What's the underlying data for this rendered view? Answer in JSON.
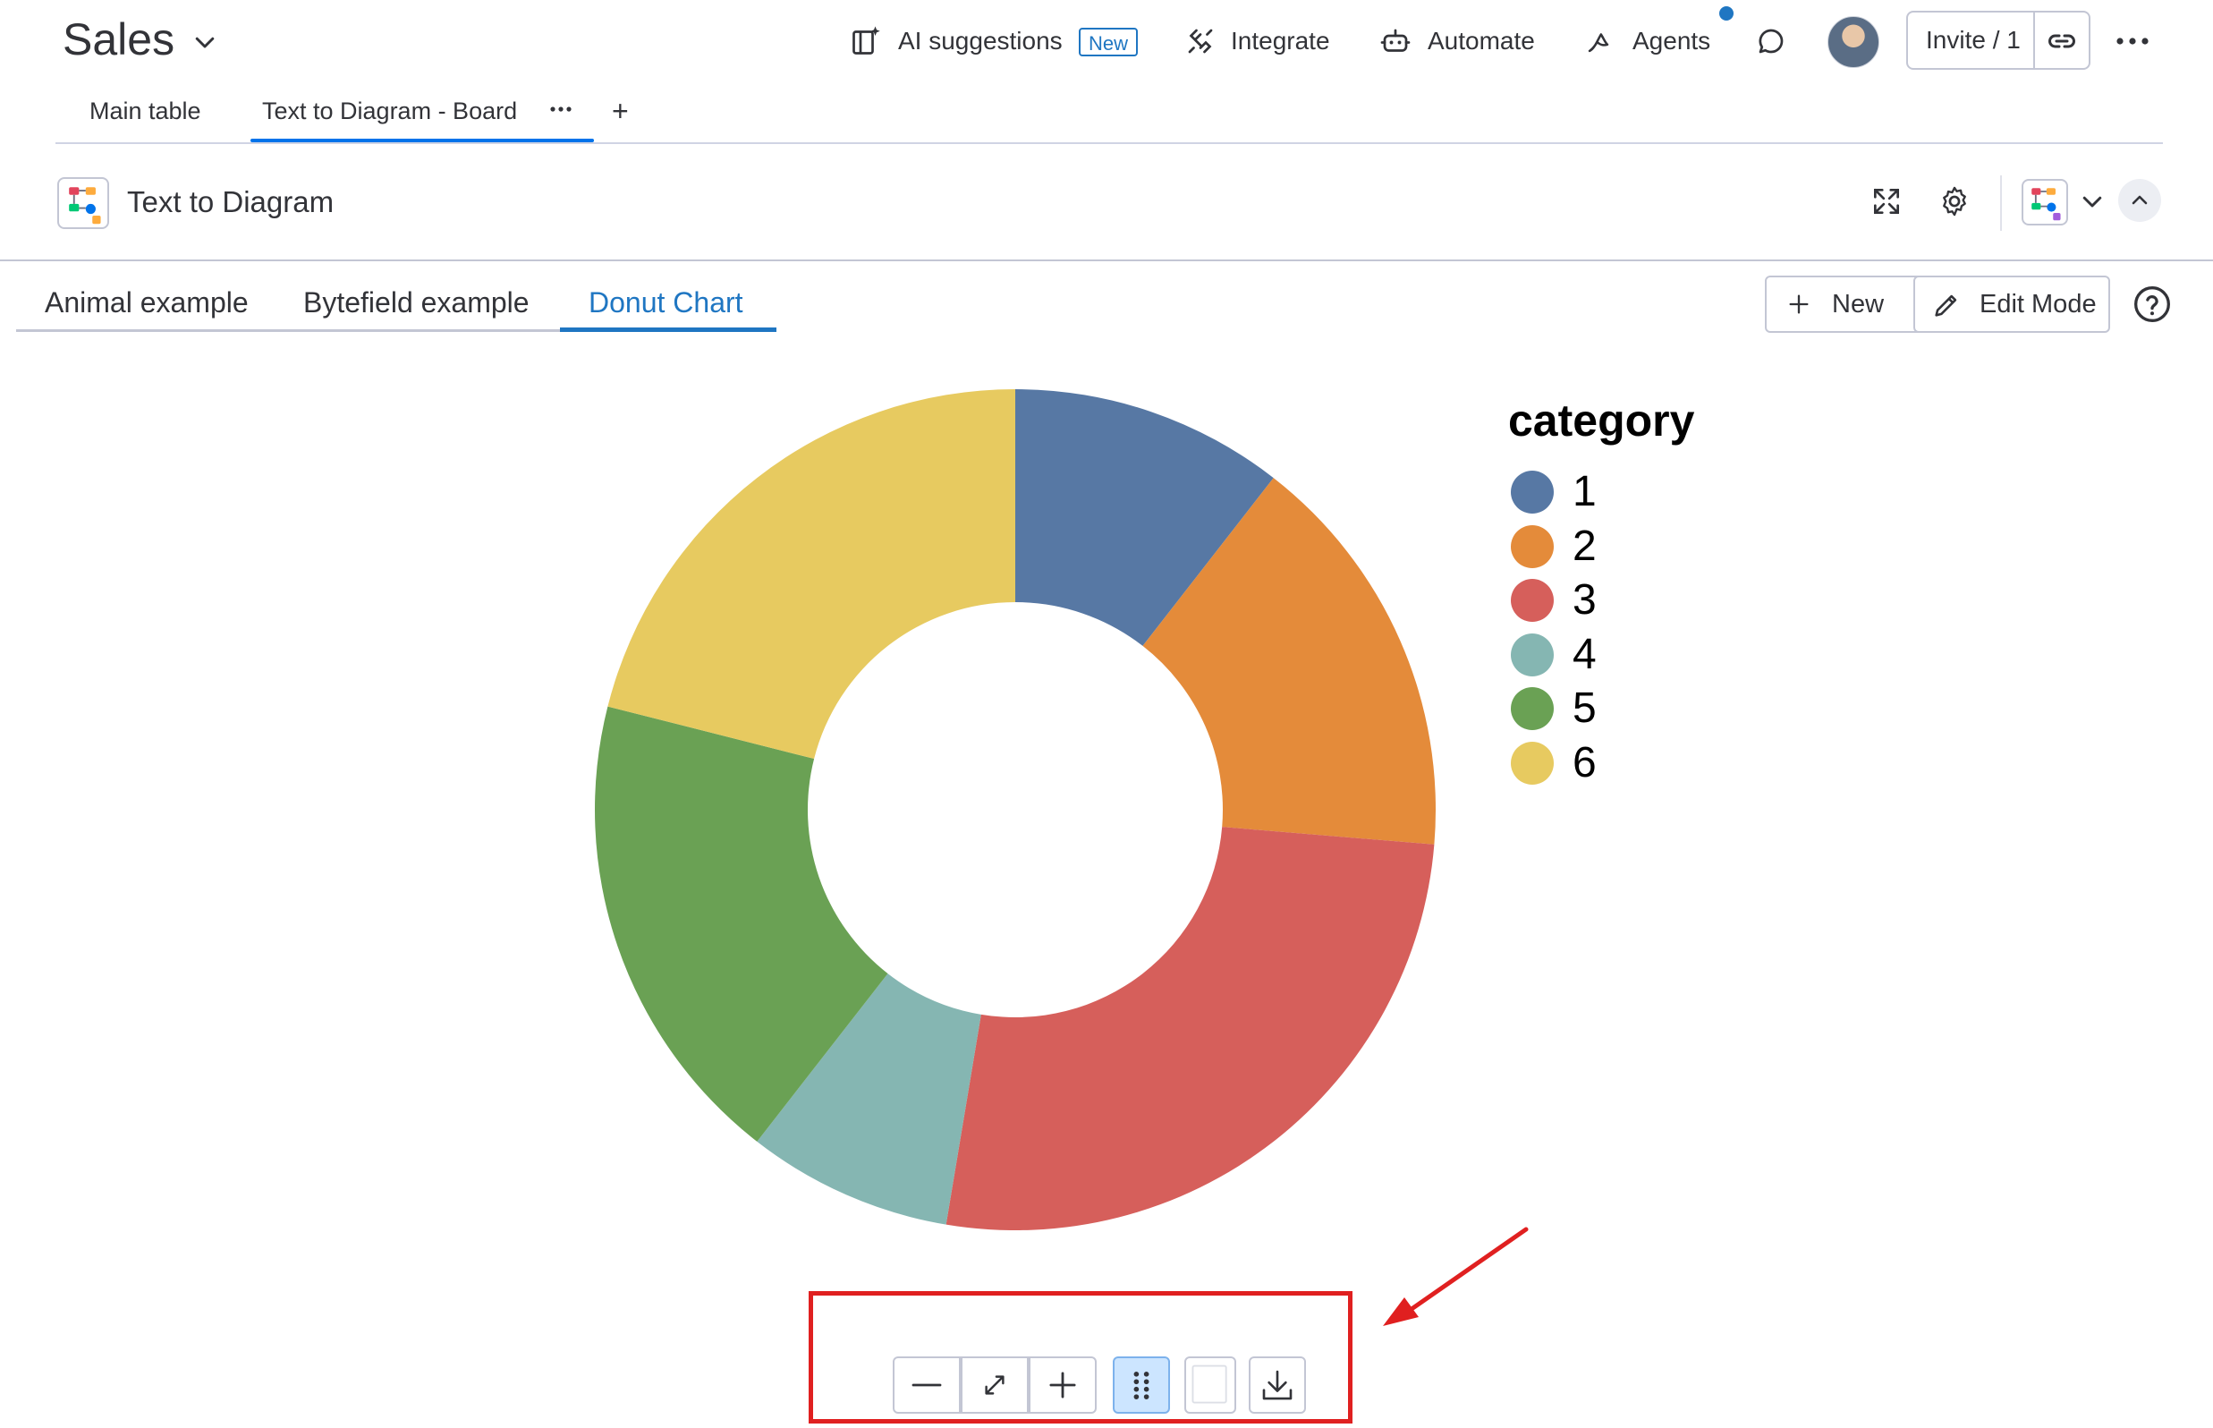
{
  "header": {
    "board_title": "Sales",
    "ai_suggestions_label": "AI suggestions",
    "new_badge": "New",
    "integrate_label": "Integrate",
    "automate_label": "Automate",
    "agents_label": "Agents",
    "invite_label": "Invite / 1"
  },
  "view_tabs": {
    "main_table": "Main table",
    "text_to_diagram_board": "Text to Diagram - Board",
    "add_view": "+"
  },
  "widget": {
    "title": "Text to Diagram"
  },
  "diagram_tabs": [
    {
      "label": "Animal example",
      "active": false
    },
    {
      "label": "Bytefield example",
      "active": false
    },
    {
      "label": "Donut Chart",
      "active": true
    }
  ],
  "actions": {
    "new_label": "New",
    "edit_mode_label": "Edit Mode"
  },
  "colors": {
    "accent": "#1f76c2",
    "monday_blue": "#0073ea",
    "highlight_red": "#e02020"
  },
  "chart_data": {
    "type": "pie",
    "donut": true,
    "legend_title": "category",
    "legend_position": "right",
    "categories": [
      "1",
      "2",
      "3",
      "4",
      "5",
      "6"
    ],
    "values": [
      4,
      6,
      10,
      3,
      7,
      8
    ],
    "colors": [
      "#5778a4",
      "#e48b3a",
      "#d65f5b",
      "#85b6b2",
      "#6aa154",
      "#e7ca60"
    ]
  },
  "toolbar": {
    "buttons": [
      "zoom-out",
      "fit-to-screen",
      "zoom-in",
      "pan-handle",
      "background-toggle",
      "download"
    ],
    "active_button": "pan-handle"
  }
}
